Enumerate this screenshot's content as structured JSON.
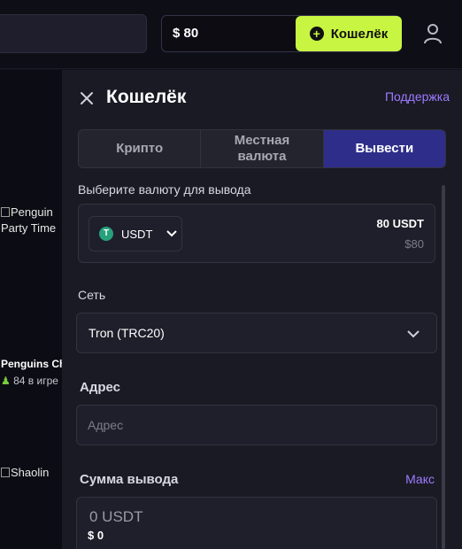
{
  "header": {
    "balance": "$ 80",
    "wallet_button": "Кошелёк",
    "wallet_button_icon": "plus-circle-icon",
    "user_icon": "user-icon"
  },
  "sidebar_games": {
    "game1_alt": "Penguin Party Time",
    "game1_alt_line1": "Penguin",
    "game1_alt_line2": "Party Time",
    "game2_title": "Penguins Ch",
    "game2_players": "84 в игре",
    "game3_alt": "Shaolin"
  },
  "panel": {
    "title": "Кошелёк",
    "support_link": "Поддержка",
    "tabs": [
      {
        "label": "Крипто",
        "active": false
      },
      {
        "label": "Местная валюта",
        "active": false
      },
      {
        "label": "Вывести",
        "active": true
      }
    ],
    "currency_label": "Выберите валюту для вывода",
    "currency": {
      "name": "USDT",
      "icon": "tether-icon",
      "amount": "80 USDT",
      "amount_usd": "$80"
    },
    "network_label": "Сеть",
    "network_value": "Tron (TRC20)",
    "address_label": "Адрес",
    "address_placeholder": "Адрес",
    "withdraw_amount_label": "Сумма вывода",
    "max_link": "Макс",
    "amount_placeholder": "0 USDT",
    "amount_usd": "$ 0"
  },
  "colors": {
    "accent_lime": "#c8f542",
    "tab_active": "#2e2e8a",
    "link_purple": "#9d7bff",
    "panel_bg": "#1a1a24"
  }
}
